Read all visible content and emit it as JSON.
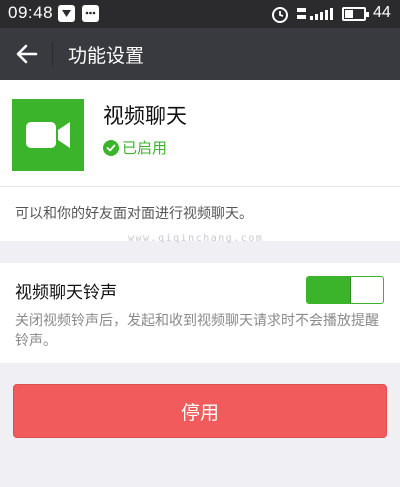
{
  "status_bar": {
    "time": "09:48",
    "battery_level": "44",
    "icons": [
      "shield-icon",
      "chat-bubble-icon",
      "alarm-icon",
      "signal-icon",
      "battery-icon"
    ]
  },
  "nav": {
    "title": "功能设置",
    "back_icon": "arrow-left-icon"
  },
  "feature": {
    "name": "视频聊天",
    "status": "已启用",
    "icon": "video-camera-icon",
    "description": "可以和你的好友面对面进行视频聊天。"
  },
  "watermark": "www.qiqinchang.com",
  "ringtone": {
    "title": "视频聊天铃声",
    "enabled": true,
    "description": "关闭视频铃声后，发起和收到视频聊天请求时不会播放提醒铃声。"
  },
  "actions": {
    "disable_label": "停用"
  },
  "colors": {
    "accent_green": "#3bb42b",
    "danger_red": "#f25b5b",
    "nav_bg": "#393a3f",
    "page_bg": "#efeff4"
  }
}
